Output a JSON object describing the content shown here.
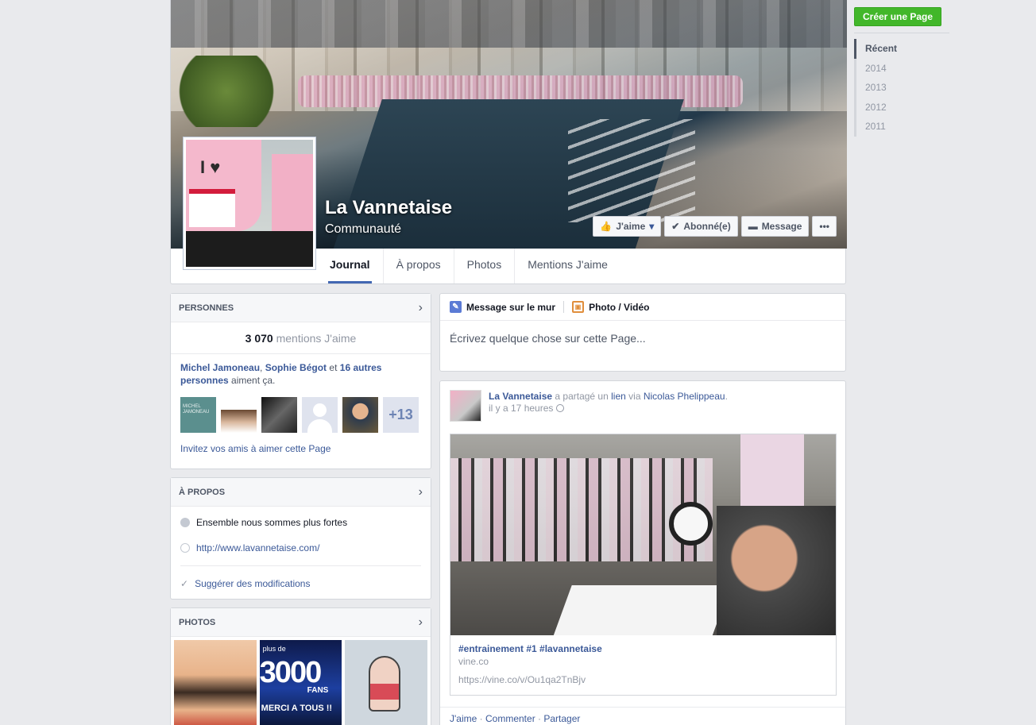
{
  "page": {
    "name": "La Vannetaise",
    "category": "Communauté"
  },
  "cover_actions": {
    "like": "J'aime",
    "subscribed": "Abonné(e)",
    "message": "Message",
    "more": "•••"
  },
  "tabs": [
    "Journal",
    "À propos",
    "Photos",
    "Mentions J'aime"
  ],
  "right_rail": {
    "create_page": "Créer une Page",
    "timeline": [
      "Récent",
      "2014",
      "2013",
      "2012",
      "2011"
    ]
  },
  "people": {
    "title": "PERSONNES",
    "likes_number": "3 070",
    "likes_label": "mentions J'aime",
    "friend1": "Michel Jamoneau",
    "sep1": ",",
    "friend2": "Sophie Bégot",
    "and": "et",
    "others": "16 autres personnes",
    "suffix": "aiment ça.",
    "avatar1_text": "MICHEL JAMONEAU",
    "more_count": "+13",
    "invite": "Invitez vos amis à aimer cette Page"
  },
  "about": {
    "title": "À PROPOS",
    "description": "Ensemble nous sommes plus fortes",
    "website": "http://www.lavannetaise.com/",
    "suggest": "Suggérer des modifications"
  },
  "photos": {
    "title": "PHOTOS",
    "photo2_plus": "plus de",
    "photo2_big": "3000",
    "photo2_fans": "FANS",
    "photo2_merci": "MERCI A TOUS !!"
  },
  "composer": {
    "tab1": "Message sur le mur",
    "tab2": "Photo / Vidéo",
    "placeholder": "Écrivez quelque chose sur cette Page..."
  },
  "post": {
    "author": "La Vannetaise",
    "shared": "a partagé un",
    "lien": "lien",
    "via": "via",
    "via_name": "Nicolas Phelippeau",
    "period": ".",
    "time": "il y a 17 heures",
    "link_title": "#entrainement #1 #lavannetaise",
    "link_domain": "vine.co",
    "link_url": "https://vine.co/v/Ou1qa2TnBjv",
    "action_like": "J'aime",
    "dot": "·",
    "action_comment": "Commenter",
    "action_share": "Partager"
  }
}
